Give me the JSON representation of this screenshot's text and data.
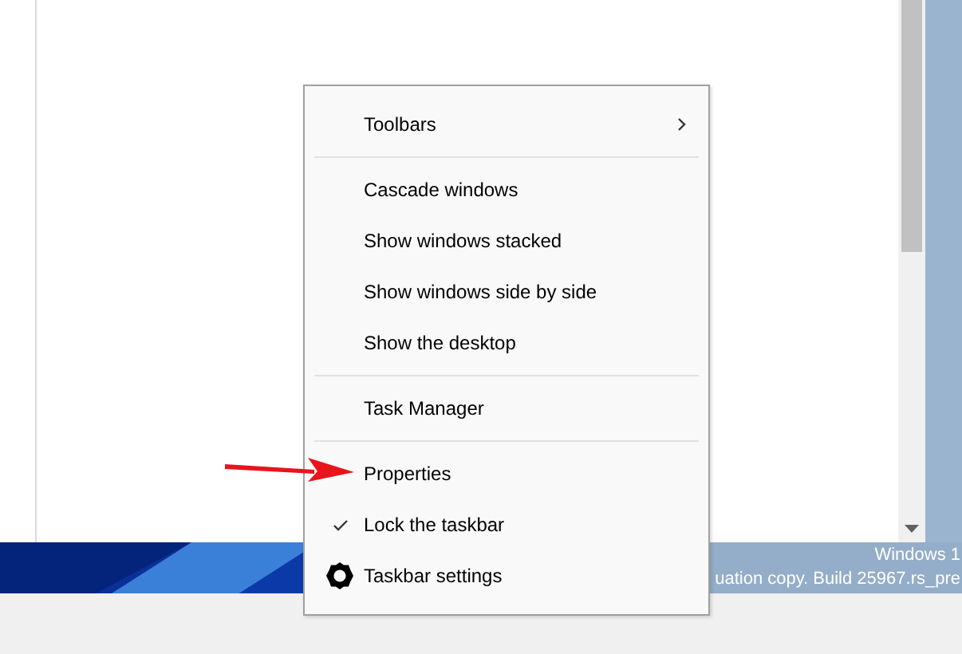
{
  "menu": {
    "items": [
      {
        "kind": "submenu",
        "label": "Toolbars"
      },
      {
        "kind": "separator"
      },
      {
        "kind": "item",
        "label": "Cascade windows"
      },
      {
        "kind": "item",
        "label": "Show windows stacked"
      },
      {
        "kind": "item",
        "label": "Show windows side by side"
      },
      {
        "kind": "item",
        "label": "Show the desktop"
      },
      {
        "kind": "separator"
      },
      {
        "kind": "item",
        "label": "Task Manager"
      },
      {
        "kind": "separator"
      },
      {
        "kind": "item",
        "label": "Properties"
      },
      {
        "kind": "check",
        "label": "Lock the taskbar",
        "checked": true
      },
      {
        "kind": "settings",
        "label": "Taskbar settings"
      }
    ]
  },
  "watermark": {
    "lines": [
      "Windows 1",
      "uation copy. Build 25967.rs_pre"
    ]
  }
}
